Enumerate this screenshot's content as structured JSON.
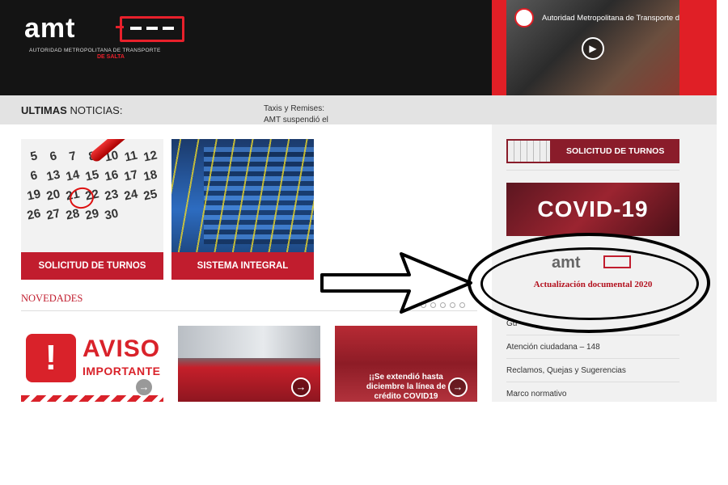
{
  "header": {
    "logo_text": "amt",
    "logo_sub1": "AUTORIDAD METROPOLITANA DE TRANSPORTE",
    "logo_sub2": "DE SALTA",
    "video_title": "Autoridad Metropolitana de Transporte de"
  },
  "newsbar": {
    "label_bold": "ULTIMAS",
    "label_rest": "NOTICIAS:",
    "ticker_line1": "Taxis y Remises:",
    "ticker_line2": "AMT suspendió el"
  },
  "cards": [
    {
      "caption": "SOLICITUD DE TURNOS"
    },
    {
      "caption": "SISTEMA INTEGRAL"
    }
  ],
  "calendar_numbers": [
    "5",
    "6",
    "7",
    "8",
    "10",
    "11",
    "12",
    "6",
    "13",
    "14",
    "15",
    "16",
    "17",
    "18",
    "19",
    "20",
    "21",
    "22",
    "23",
    "24",
    "25",
    "26",
    "27",
    "28",
    "29",
    "30"
  ],
  "novedades": {
    "title": "NOVEDADES"
  },
  "thumbs": [
    {
      "title_big": "AVISO",
      "title_small": "IMPORTANTE"
    },
    {
      "title": ""
    },
    {
      "message": "¡¡Se extendió hasta diciembre la línea de crédito COVID19"
    }
  ],
  "sidebar": {
    "turnos_label": "SOLICITUD DE TURNOS",
    "covid_label": "COVID-19",
    "actual_logo": "amt",
    "actual_caption": "Actualización documental 2020",
    "links": [
      "Gu",
      "Atención ciudadana – 148",
      "Reclamos, Quejas y Sugerencias",
      "Marco normativo"
    ]
  },
  "icons": {
    "play": "▶",
    "arrow_right": "→",
    "exclamation": "!"
  },
  "colors": {
    "brand_red": "#c11d2e",
    "header_bg": "#141414",
    "video_red": "#e01f26"
  }
}
